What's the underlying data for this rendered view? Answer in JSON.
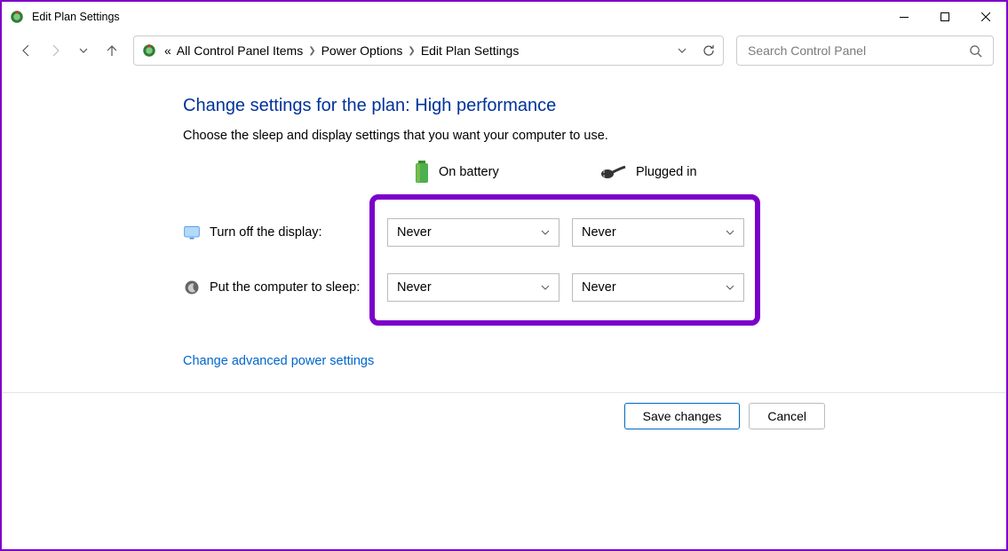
{
  "window": {
    "title": "Edit Plan Settings"
  },
  "breadcrumb": {
    "item1": "All Control Panel Items",
    "item2": "Power Options",
    "item3": "Edit Plan Settings",
    "prefix": "«"
  },
  "search": {
    "placeholder": "Search Control Panel"
  },
  "page": {
    "heading": "Change settings for the plan: High performance",
    "subtext": "Choose the sleep and display settings that you want your computer to use.",
    "col_battery": "On battery",
    "col_plugged": "Plugged in",
    "row1_label": "Turn off the display:",
    "row2_label": "Put the computer to sleep:",
    "r1c1": "Never",
    "r1c2": "Never",
    "r2c1": "Never",
    "r2c2": "Never",
    "advanced_link": "Change advanced power settings"
  },
  "buttons": {
    "save": "Save changes",
    "cancel": "Cancel"
  }
}
